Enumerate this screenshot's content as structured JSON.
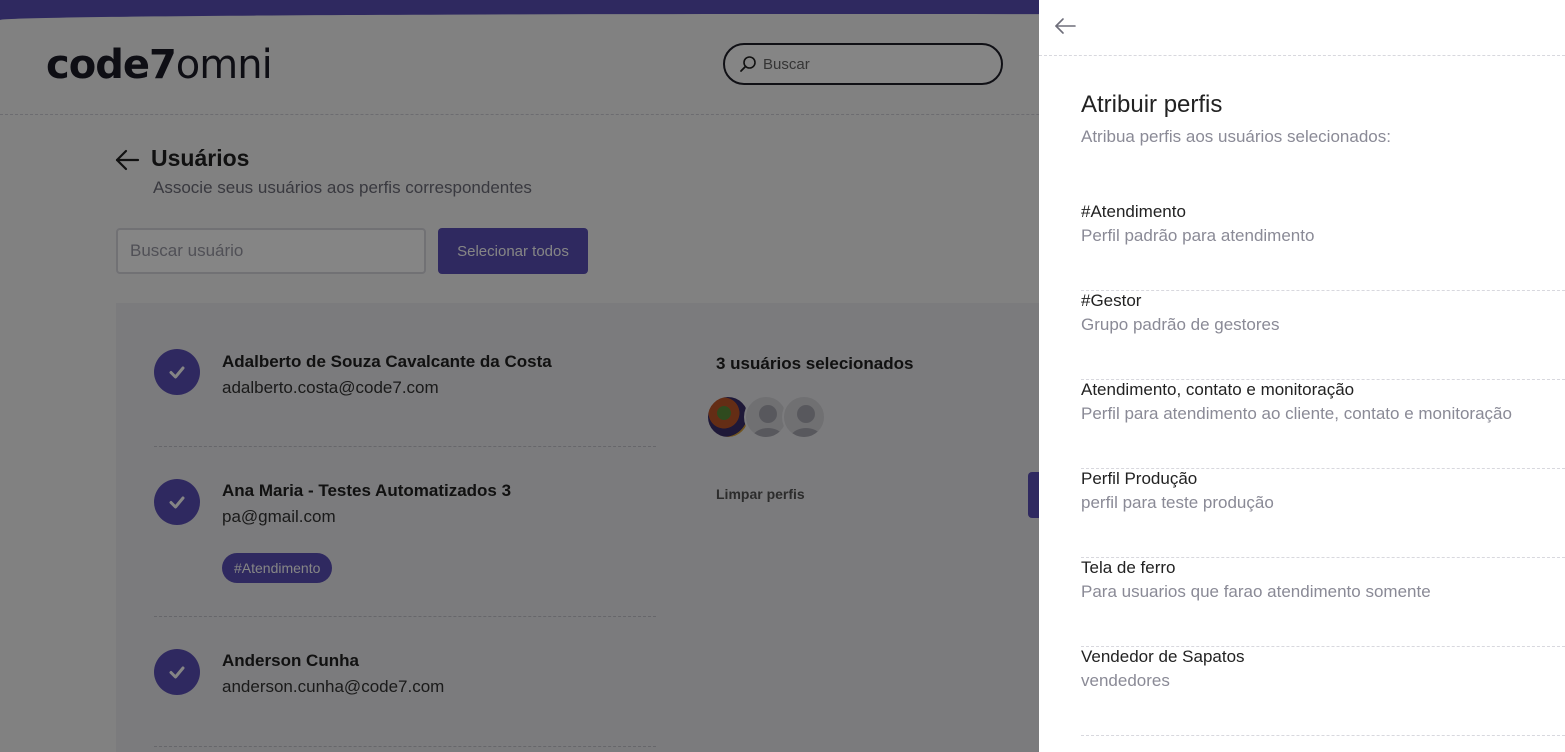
{
  "app": {
    "logo": {
      "bold": "code7",
      "light": "omni"
    },
    "search": {
      "placeholder": "Buscar"
    }
  },
  "page": {
    "title": "Usuários",
    "subtitle": "Associe seus usuários aos perfis correspondentes",
    "user_search_placeholder": "Buscar usuário",
    "select_all_label": "Selecionar todos"
  },
  "users": [
    {
      "name": "Adalberto de Souza Cavalcante da Costa",
      "email": "adalberto.costa@code7.com",
      "tag": ""
    },
    {
      "name": "Ana Maria - Testes Automatizados 3",
      "email": "pa@gmail.com",
      "tag": "#Atendimento"
    },
    {
      "name": "Anderson Cunha",
      "email": "anderson.cunha@code7.com",
      "tag": ""
    }
  ],
  "selection": {
    "title": "3 usuários selecionados",
    "clear_label": "Limpar perfis"
  },
  "drawer": {
    "title": "Atribuir perfis",
    "subtitle": "Atribua perfis aos usuários selecionados:",
    "profiles": [
      {
        "name": "#Atendimento",
        "description": "Perfil padrão para atendimento"
      },
      {
        "name": "#Gestor",
        "description": "Grupo padrão de gestores"
      },
      {
        "name": "Atendimento, contato e monitoração",
        "description": "Perfil para atendimento ao cliente, contato e monitoração"
      },
      {
        "name": "Perfil Produção",
        "description": "perfil para teste produção"
      },
      {
        "name": "Tela de ferro",
        "description": "Para usuarios que farao atendimento somente"
      },
      {
        "name": "Vendedor de Sapatos",
        "description": "vendedores"
      }
    ]
  },
  "colors": {
    "accent": "#5b4fb8",
    "overlay": "rgba(0,0,0,0.48)"
  }
}
